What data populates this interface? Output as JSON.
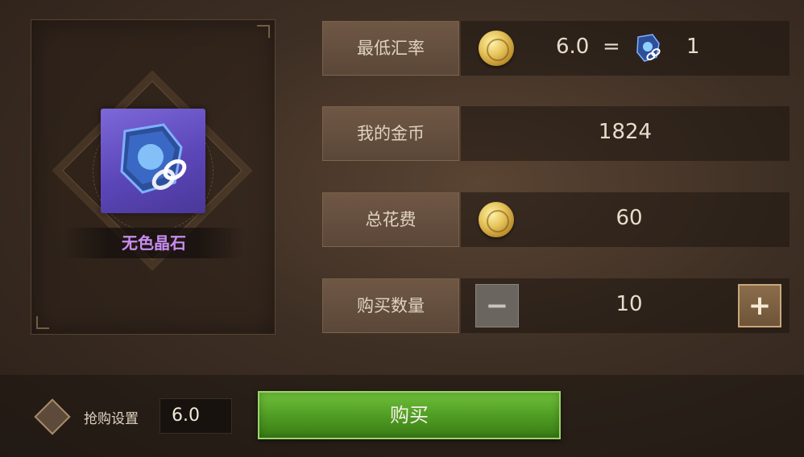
{
  "item": {
    "name": "无色晶石",
    "icon": "colorless-crystal-icon",
    "name_color": "#c98cf2"
  },
  "rows": {
    "exchange_rate": {
      "label": "最低汇率",
      "coin_amount": "6.0",
      "equals": "=",
      "crystal_amount": "1"
    },
    "my_gold": {
      "label": "我的金币",
      "value": "1824"
    },
    "total_cost": {
      "label": "总花费",
      "value": "60"
    },
    "quantity": {
      "label": "购买数量",
      "value": "10",
      "minus": "−",
      "plus": "+"
    }
  },
  "bottom": {
    "setting_label": "抢购设置",
    "setting_value": "6.0",
    "buy_label": "购买",
    "buy_color": "#4e9a23"
  }
}
